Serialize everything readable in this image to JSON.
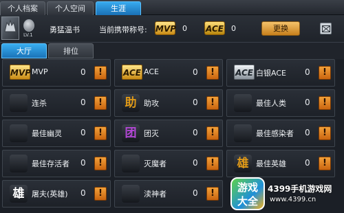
{
  "tabs": [
    {
      "label": "个人档案",
      "active": false
    },
    {
      "label": "个人空间",
      "active": false
    },
    {
      "label": "生涯",
      "active": true
    }
  ],
  "player": {
    "level": "LV.1",
    "nickname": "勇猛温书",
    "title_label": "当前携带称号:",
    "mvp_badge": "MVP",
    "mvp_count": "0",
    "ace_badge": "ACE",
    "ace_count": "0",
    "switch_label": "更换",
    "mail_icon": "close-mail-icon"
  },
  "subtabs": [
    {
      "label": "大厅",
      "active": true
    },
    {
      "label": "排位",
      "active": false
    }
  ],
  "achievements": [
    {
      "icon": "mvp-badge-icon",
      "badge": "MVP",
      "label": "MVP",
      "count": "0",
      "style": "mvp"
    },
    {
      "icon": "ace-badge-icon",
      "badge": "ACE",
      "label": "ACE",
      "count": "0",
      "style": "ace"
    },
    {
      "icon": "silver-ace-badge-icon",
      "badge": "ACE",
      "label": "白银ACE",
      "count": "0",
      "style": "sace"
    },
    {
      "icon": "consecutive-kill-icon",
      "badge": "",
      "label": "连杀",
      "count": "0",
      "style": "hanzi",
      "color": "#e23b2e"
    },
    {
      "icon": "assist-icon",
      "badge": "助",
      "label": "助攻",
      "count": "0",
      "style": "hanzi",
      "color": "#e09a18"
    },
    {
      "icon": "best-human-icon",
      "badge": "",
      "label": "最佳人类",
      "count": "0",
      "style": "hanzi",
      "color": "#9aa6b2"
    },
    {
      "icon": "skull-icon",
      "badge": "",
      "label": "最佳幽灵",
      "count": "0",
      "style": "hanzi",
      "color": "#ffffff"
    },
    {
      "icon": "team-wipe-icon",
      "badge": "团",
      "label": "团灭",
      "count": "0",
      "style": "hanzi",
      "color": "#b347d6"
    },
    {
      "icon": "biohazard-icon",
      "badge": "",
      "label": "最佳感染者",
      "count": "0",
      "style": "hanzi",
      "color": "#7ed321"
    },
    {
      "icon": "survivor-fist-icon",
      "badge": "",
      "label": "最佳存活者",
      "count": "0",
      "style": "hanzi",
      "color": "#2f7fe0"
    },
    {
      "icon": "demon-slayer-icon",
      "badge": "",
      "label": "灭魔者",
      "count": "0",
      "style": "hanzi",
      "color": "#e23b2e"
    },
    {
      "icon": "best-hero-icon",
      "badge": "雄",
      "label": "最佳英雄",
      "count": "0",
      "style": "hanzi",
      "color": "#e09a18"
    },
    {
      "icon": "butcher-hero-icon",
      "badge": "雄",
      "label": "屠夫(英雄)",
      "count": "0",
      "style": "hanzi",
      "color": "#ffffff"
    },
    {
      "icon": "god-slayer-icon",
      "badge": "",
      "label": "渎神者",
      "count": "0",
      "style": "hanzi",
      "color": "#e23b2e"
    }
  ],
  "watermark": {
    "logo_line1": "游戏",
    "logo_line2": "大全",
    "text": "4399手机游戏网",
    "url": "www.4399.cn"
  }
}
